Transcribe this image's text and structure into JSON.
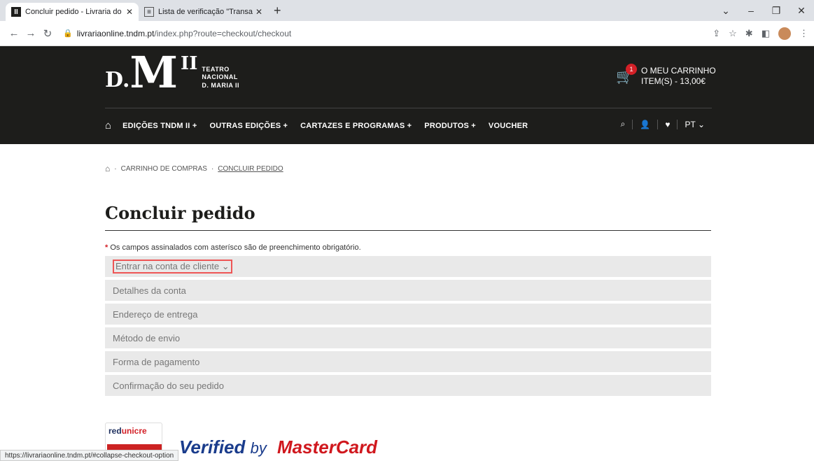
{
  "browser": {
    "tabs": [
      {
        "title": "Concluir pedido - Livraria do Tea",
        "active": true
      },
      {
        "title": "Lista de verificação \"Transação\"",
        "active": false
      }
    ],
    "url_host": "livrariaonline.tndm.pt",
    "url_path": "/index.php?route=checkout/checkout",
    "status_url": "https://livrariaonline.tndm.pt/#collapse-checkout-option"
  },
  "header": {
    "logo_d": "D.",
    "logo_m": "M",
    "logo_ii": "II",
    "logo_sub1": "TEATRO",
    "logo_sub2": "NACIONAL",
    "logo_sub3": "D. MARIA II",
    "cart_count": "1",
    "cart_line1": "O MEU CARRINHO",
    "cart_line2": "ITEM(S) - 13,00€",
    "nav": [
      "EDIÇÕES TNDM II +",
      "OUTRAS EDIÇÕES +",
      "CARTAZES E PROGRAMAS +",
      "PRODUTOS +",
      "VOUCHER"
    ],
    "lang": "PT"
  },
  "breadcrumb": {
    "items": [
      "CARRINHO DE COMPRAS",
      "CONCLUIR PEDIDO"
    ]
  },
  "page": {
    "title": "Concluir pedido",
    "required_note": "Os campos assinalados com asterísco são de preenchimento obrigatório.",
    "panels": [
      "Entrar na conta de cliente",
      "Detalhes da conta",
      "Endereço de entrega",
      "Método de envio",
      "Forma de pagamento",
      "Confirmação do seu pedido"
    ]
  },
  "payment_logos": {
    "redunicre_a": "red",
    "redunicre_b": "unicre",
    "verified": "Verified",
    "verified_by": "by",
    "mastercard": "MasterCard"
  }
}
